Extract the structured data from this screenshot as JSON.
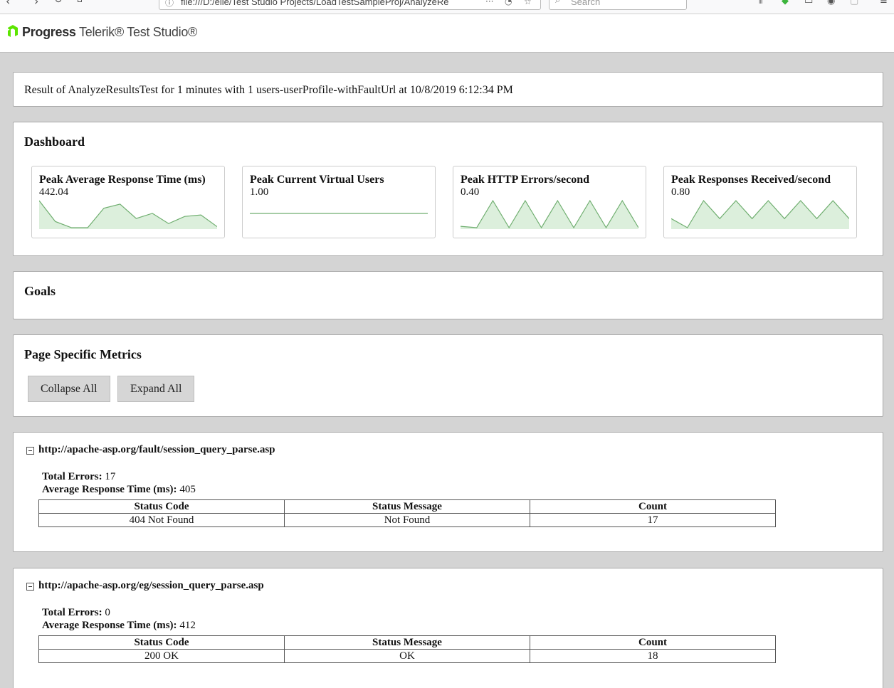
{
  "browser": {
    "url": "file:///D:/elle/Test Studio Projects/LoadTestSampleProj/AnalyzeRe",
    "search_placeholder": "Search"
  },
  "logo": {
    "brand": "Progress",
    "product": "Telerik® Test Studio®",
    "brand_color": "#5ce500"
  },
  "result": {
    "text": "Result of AnalyzeResultsTest for 1 minutes with 1 users-userProfile-withFaultUrl at 10/8/2019 6:12:34 PM"
  },
  "dashboard": {
    "title": "Dashboard",
    "cards": [
      {
        "title": "Peak Average Response Time (ms)",
        "value": "442.04",
        "series": [
          442,
          340,
          310,
          310,
          405,
          425,
          355,
          380,
          330,
          365,
          372,
          315
        ]
      },
      {
        "title": "Peak Current Virtual Users",
        "value": "1.00",
        "series": [
          1,
          1,
          1,
          1,
          1,
          1,
          1,
          1,
          1,
          1,
          1,
          1
        ]
      },
      {
        "title": "Peak HTTP Errors/second",
        "value": "0.40",
        "series": [
          0.02,
          0,
          0.4,
          0,
          0.4,
          0,
          0.4,
          0,
          0.4,
          0,
          0.4,
          0
        ]
      },
      {
        "title": "Peak Responses Received/second",
        "value": "0.80",
        "series": [
          0.4,
          0.2,
          0.8,
          0.4,
          0.8,
          0.4,
          0.8,
          0.4,
          0.8,
          0.4,
          0.8,
          0.4
        ]
      }
    ],
    "spark_line_color": "#6fae6f",
    "spark_fill_color": "#dcefdc"
  },
  "goals": {
    "title": "Goals"
  },
  "page_metrics": {
    "title": "Page Specific Metrics",
    "collapse_label": "Collapse All",
    "expand_label": "Expand All"
  },
  "pages": [
    {
      "url": "http://apache-asp.org/fault/session_query_parse.asp",
      "total_errors_label": "Total Errors:",
      "total_errors": "17",
      "avg_response_label": "Average Response Time (ms):",
      "avg_response": "405",
      "columns": [
        "Status Code",
        "Status Message",
        "Count"
      ],
      "rows": [
        [
          "404 Not Found",
          "Not Found",
          "17"
        ]
      ]
    },
    {
      "url": "http://apache-asp.org/eg/session_query_parse.asp",
      "total_errors_label": "Total Errors:",
      "total_errors": "0",
      "avg_response_label": "Average Response Time (ms):",
      "avg_response": "412",
      "columns": [
        "Status Code",
        "Status Message",
        "Count"
      ],
      "rows": [
        [
          "200 OK",
          "OK",
          "18"
        ]
      ]
    }
  ]
}
